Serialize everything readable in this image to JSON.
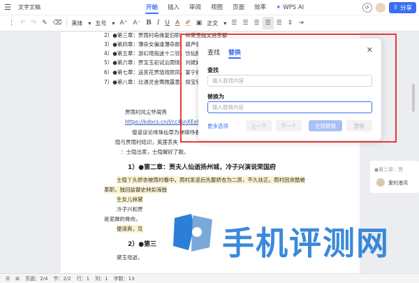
{
  "title_bar": {
    "doc_title": "文字文稿",
    "tabs": [
      "开始",
      "插入",
      "审阅",
      "视图",
      "页面",
      "效率"
    ],
    "active_tab": "开始",
    "wps_ai": "WPS AI",
    "share": "分享"
  },
  "toolbar": {
    "font_family": "黑体",
    "font_size": "五号",
    "style": "正文"
  },
  "document": {
    "toc_lines": [
      "2）●第三章：贾雨村奇缘复旧职，林黛玉抛父进京都",
      "3）●第四章：薄命女偏逢薄命郎，葫芦僧",
      "4）●第五章：游幻境指迷十二钗，饮仙醪",
      "5）●第六章：贾宝玉初试云雨情，刘姥姥",
      "6）●第七章：送宫花贾琏戏熙凤，宴宁府",
      "7）●第八章：比通灵金莺微露意，探宝钗"
    ],
    "line_a": "贾雨村风尘怀闺秀",
    "link": "https://kdocs.cn/l/cc4snXExU",
    "line_b": "僧道谈论绛珠仙草为神瑛侍者还",
    "line_c": "隐与贾雨村结识，英莲丢失",
    "line_d": "：士隐出家，士隐解好了歌。",
    "heading_1": "1）●第二章：贾夫人仙逝扬州城，冷子兴演说荣国府",
    "para_1": "士隐丫头娇杏被雨村看中。雨村发迹后先娶娇杏为二房，不久扶正。雨村因贪酷被",
    "para_2": "革职，独回盐御史林如海独",
    "para_3": "生女儿林黛",
    "para_4": "冷子兴和贾",
    "para_5": "是泥做的骨肉，",
    "para_6": "便清爽，见",
    "heading_2": "2）●第三",
    "para_7": "黛玉母逝，"
  },
  "sidebar_comment": {
    "quote": "●第二章：贾",
    "user": "爱的港湾"
  },
  "dialog": {
    "tab_find": "查找",
    "tab_replace": "替换",
    "find_label": "查找",
    "find_placeholder": "输入查找内容",
    "replace_label": "替换为",
    "replace_placeholder": "输入替换内容",
    "more_options": "更多选项",
    "prev": "上一个",
    "next": "下一个",
    "replace_all": "全部替换",
    "replace": "替换"
  },
  "status_bar": {
    "page": "页面：2/4",
    "section": "节：2/2",
    "row": "行：1",
    "col": "列：1",
    "words": "字数：13"
  },
  "watermark": {
    "text": "手机评测网"
  },
  "colors": {
    "accent": "#3b6ef6",
    "highlight_box": "#e53935",
    "watermark": "#2b7fd8"
  }
}
